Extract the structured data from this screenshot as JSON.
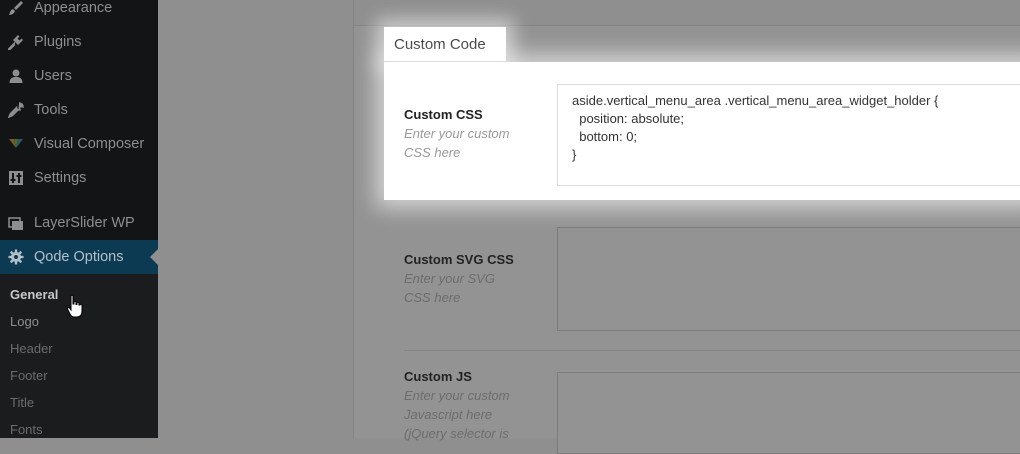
{
  "sidebar": {
    "items": [
      {
        "label": "Appearance",
        "icon": "paintbrush-icon"
      },
      {
        "label": "Plugins",
        "icon": "plug-icon"
      },
      {
        "label": "Users",
        "icon": "user-icon"
      },
      {
        "label": "Tools",
        "icon": "wrench-icon"
      },
      {
        "label": "Visual Composer",
        "icon": "visual-composer-icon"
      },
      {
        "label": "Settings",
        "icon": "settings-icon"
      },
      {
        "label": "LayerSlider WP",
        "icon": "layers-icon"
      },
      {
        "label": "Qode Options",
        "icon": "gear-icon"
      }
    ],
    "submenu": [
      "General",
      "Logo",
      "Header",
      "Footer",
      "Title",
      "Fonts"
    ],
    "active_color": "#0b3a52"
  },
  "section": {
    "title": "Custom Code"
  },
  "fields": {
    "custom_css": {
      "label": "Custom CSS",
      "help": "Enter your custom CSS here",
      "value": "aside.vertical_menu_area .vertical_menu_area_widget_holder {\n  position: absolute;\n  bottom: 0;\n}"
    },
    "custom_svg_css": {
      "label": "Custom SVG CSS",
      "help": "Enter your SVG CSS here",
      "value": ""
    },
    "custom_js": {
      "label": "Custom JS",
      "help": "Enter your custom Javascript here (jQuery selector is",
      "value": ""
    }
  }
}
